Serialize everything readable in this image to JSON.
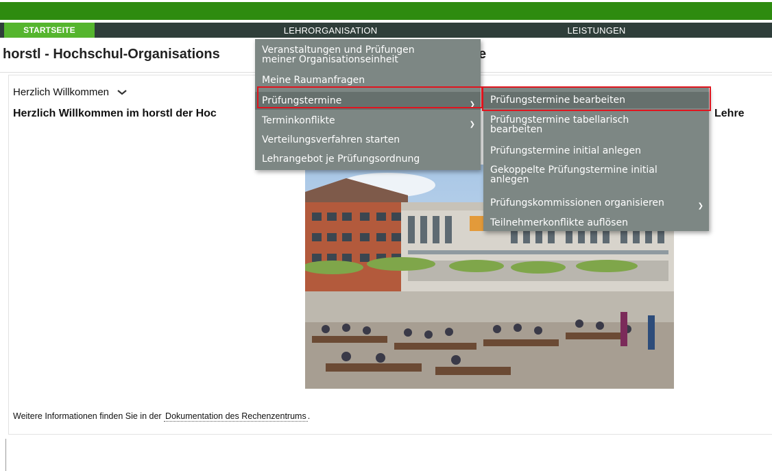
{
  "nav": {
    "items": [
      "STARTSEITE",
      "LEHRORGANISATION",
      "LEISTUNGEN"
    ]
  },
  "page": {
    "title": "horstl - Hochschul-Organisations",
    "title_tail": "e"
  },
  "welcome": {
    "heading": "Herzlich Willkommen",
    "line": "Herzlich Willkommen im horstl der Hoc",
    "line_end": "Lehre"
  },
  "footer": {
    "prefix": "Weitere Informationen finden Sie in der",
    "link": "Dokumentation des Rechenzentrums",
    "suffix": "."
  },
  "menu": {
    "items": [
      "Veranstaltungen und Prüfungen meiner Organisationseinheit",
      "Meine Raumanfragen",
      "Prüfungstermine",
      "Terminkonflikte",
      "Verteilungsverfahren starten",
      "Lehrangebot je Prüfungsordnung"
    ],
    "item0_line1": "Veranstaltungen und Prüfungen",
    "item0_line2": "meiner Organisationseinheit"
  },
  "submenu": {
    "items": [
      "Prüfungstermine bearbeiten",
      "Prüfungstermine tabellarisch bearbeiten",
      "Prüfungstermine initial anlegen",
      "Gekoppelte Prüfungstermine initial anlegen",
      "Prüfungskommissionen organisieren",
      "Teilnehmerkonflikte auflösen"
    ],
    "item1_line1": "Prüfungstermine tabellarisch",
    "item1_line2": "bearbeiten",
    "item3_line1": "Gekoppelte Prüfungstermine initial",
    "item3_line2": "anlegen"
  },
  "colors": {
    "brand_green": "#2e8b0f",
    "start_tab": "#55b52e",
    "navbar": "#2f3e3a",
    "menu_bg": "#7d8784",
    "highlight": "#e0141e"
  },
  "icons": [
    "chevron-down-icon",
    "chevron-right-icon"
  ]
}
